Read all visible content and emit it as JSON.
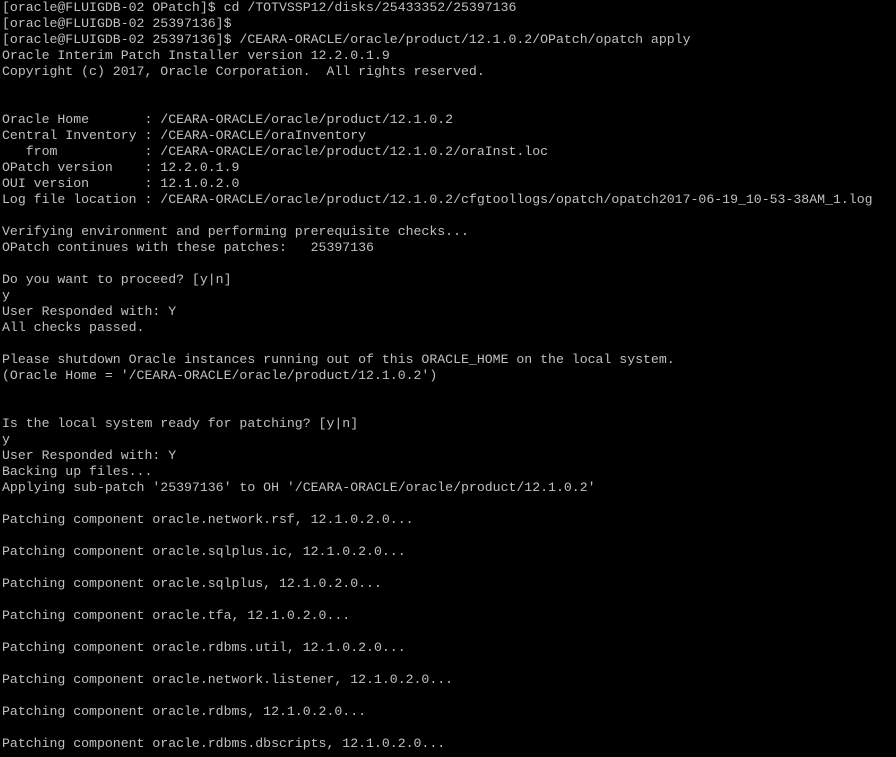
{
  "terminal": {
    "colors": {
      "background": "#000000",
      "foreground": "#c0c0c0"
    },
    "lines": [
      "[oracle@FLUIGDB-02 OPatch]$ cd /TOTVSSP12/disks/25433352/25397136",
      "[oracle@FLUIGDB-02 25397136]$",
      "[oracle@FLUIGDB-02 25397136]$ /CEARA-ORACLE/oracle/product/12.1.0.2/OPatch/opatch apply",
      "Oracle Interim Patch Installer version 12.2.0.1.9",
      "Copyright (c) 2017, Oracle Corporation.  All rights reserved.",
      "",
      "",
      "Oracle Home       : /CEARA-ORACLE/oracle/product/12.1.0.2",
      "Central Inventory : /CEARA-ORACLE/oraInventory",
      "   from           : /CEARA-ORACLE/oracle/product/12.1.0.2/oraInst.loc",
      "OPatch version    : 12.2.0.1.9",
      "OUI version       : 12.1.0.2.0",
      "Log file location : /CEARA-ORACLE/oracle/product/12.1.0.2/cfgtoollogs/opatch/opatch2017-06-19_10-53-38AM_1.log",
      "",
      "Verifying environment and performing prerequisite checks...",
      "OPatch continues with these patches:   25397136",
      "",
      "Do you want to proceed? [y|n]",
      "y",
      "User Responded with: Y",
      "All checks passed.",
      "",
      "Please shutdown Oracle instances running out of this ORACLE_HOME on the local system.",
      "(Oracle Home = '/CEARA-ORACLE/oracle/product/12.1.0.2')",
      "",
      "",
      "Is the local system ready for patching? [y|n]",
      "y",
      "User Responded with: Y",
      "Backing up files...",
      "Applying sub-patch '25397136' to OH '/CEARA-ORACLE/oracle/product/12.1.0.2'",
      "",
      "Patching component oracle.network.rsf, 12.1.0.2.0...",
      "",
      "Patching component oracle.sqlplus.ic, 12.1.0.2.0...",
      "",
      "Patching component oracle.sqlplus, 12.1.0.2.0...",
      "",
      "Patching component oracle.tfa, 12.1.0.2.0...",
      "",
      "Patching component oracle.rdbms.util, 12.1.0.2.0...",
      "",
      "Patching component oracle.network.listener, 12.1.0.2.0...",
      "",
      "Patching component oracle.rdbms, 12.1.0.2.0...",
      "",
      "Patching component oracle.rdbms.dbscripts, 12.1.0.2.0..."
    ]
  }
}
